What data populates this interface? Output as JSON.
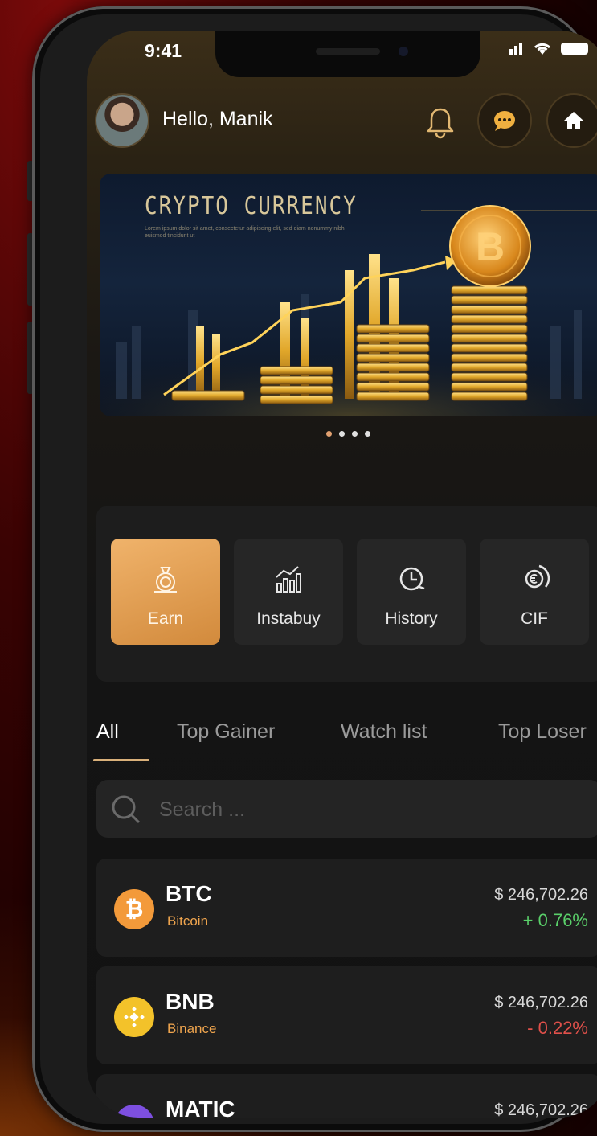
{
  "status_bar": {
    "time": "9:41"
  },
  "header": {
    "greeting": "Hello, Manik",
    "icons": [
      "bell-icon",
      "chat-icon",
      "home-icon"
    ],
    "accent": "#d9b07a"
  },
  "banner": {
    "title": "CRYPTO CURRENCY",
    "subtitle": "Lorem ipsum dolor sit amet, consectetur adipiscing elit, sed diam nonummy nibh euismod tincidunt ut",
    "carousel_pages": 4,
    "active_page": 1
  },
  "quick_actions": [
    {
      "label": "Earn",
      "icon": "money-bag-icon",
      "active": true
    },
    {
      "label": "Instabuy",
      "icon": "growth-chart-icon",
      "active": false
    },
    {
      "label": "History",
      "icon": "clock-history-icon",
      "active": false
    },
    {
      "label": "CIF",
      "icon": "euro-coin-icon",
      "active": false
    }
  ],
  "tabs": [
    {
      "label": "All",
      "active": true
    },
    {
      "label": "Top Gainer",
      "active": false
    },
    {
      "label": "Watch list",
      "active": false
    },
    {
      "label": "Top Loser",
      "active": false
    }
  ],
  "search": {
    "placeholder": "Search ..."
  },
  "coins": [
    {
      "symbol": "BTC",
      "name": "Bitcoin",
      "price": "$ 246,702.26",
      "change": "+ 0.76%",
      "change_color": "#5ad06a",
      "icon_color": "#f39a3a"
    },
    {
      "symbol": "BNB",
      "name": "Binance",
      "price": "$ 246,702.26",
      "change": "- 0.22%",
      "change_color": "#e0504a",
      "icon_color": "#f3c22a"
    },
    {
      "symbol": "MATIC",
      "name": "",
      "price": "$ 246,702.26",
      "change": "",
      "change_color": "#5ad06a",
      "icon_color": "#7d4fe0"
    }
  ]
}
